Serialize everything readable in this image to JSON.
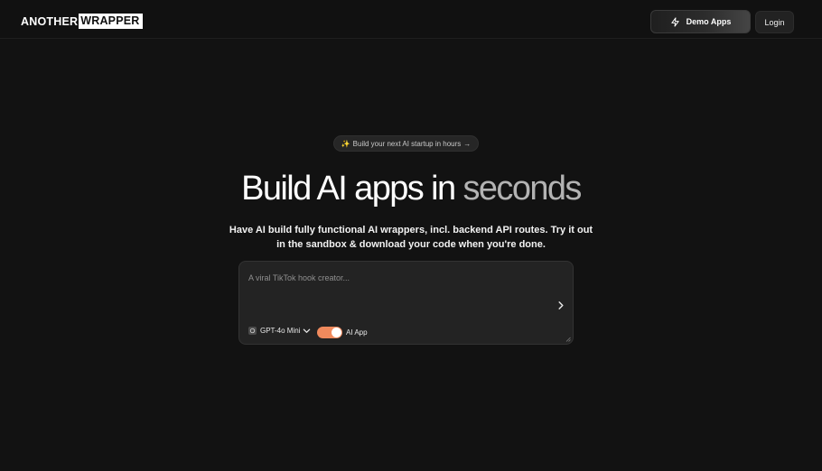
{
  "header": {
    "logo_part1": "ANOTHER",
    "logo_part2": "WRAPPER",
    "demo_label": "Demo Apps",
    "login_label": "Login"
  },
  "hero": {
    "badge_text": "Build your next AI startup in hours",
    "title_part1": "Build AI apps in ",
    "title_part2": "seconds",
    "subtitle": "Have AI build fully functional AI wrappers, incl. backend API routes. Try it out in the sandbox & download your code when you're done."
  },
  "prompt": {
    "placeholder": "A viral TikTok hook creator...",
    "value": "",
    "model_selected": "GPT-4o Mini",
    "toggle_label": "AI App",
    "toggle_on": true
  },
  "icons": {
    "demo": "lightning-icon",
    "badge": "sparkle-icon",
    "badge_arrow": "arrow-right-icon",
    "submit": "chevron-right-icon",
    "model": "model-logo-icon",
    "model_dropdown": "chevron-down-icon"
  },
  "colors": {
    "background": "#121212",
    "toggle_accent": "#f08a5d",
    "sparkle": "#f3c845"
  }
}
